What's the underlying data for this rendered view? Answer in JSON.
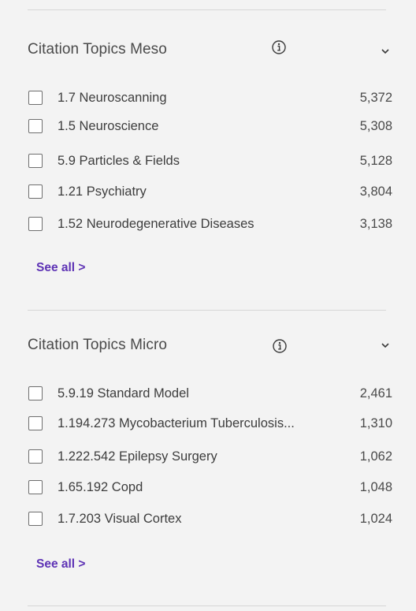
{
  "meso": {
    "title": "Citation Topics Meso",
    "items": [
      {
        "label": "1.7 Neuroscanning",
        "count": "5,372"
      },
      {
        "label": "1.5 Neuroscience",
        "count": "5,308"
      },
      {
        "label": "5.9 Particles & Fields",
        "count": "5,128"
      },
      {
        "label": "1.21 Psychiatry",
        "count": "3,804"
      },
      {
        "label": "1.52 Neurodegenerative Diseases",
        "count": "3,138"
      }
    ],
    "see_all": "See all >"
  },
  "micro": {
    "title": "Citation Topics Micro",
    "items": [
      {
        "label": "5.9.19 Standard Model",
        "count": "2,461"
      },
      {
        "label": "1.194.273 Mycobacterium Tuberculosis...",
        "count": "1,310"
      },
      {
        "label": "1.222.542 Epilepsy Surgery",
        "count": "1,062"
      },
      {
        "label": "1.65.192 Copd",
        "count": "1,048"
      },
      {
        "label": "1.7.203 Visual Cortex",
        "count": "1,024"
      }
    ],
    "see_all": "See all >"
  },
  "colors": {
    "background": "#f3f3f3",
    "link": "#5e33b5",
    "divider": "#d6d6d6"
  },
  "icons": {
    "info": "info-icon",
    "expand": "chevron-down-icon"
  }
}
